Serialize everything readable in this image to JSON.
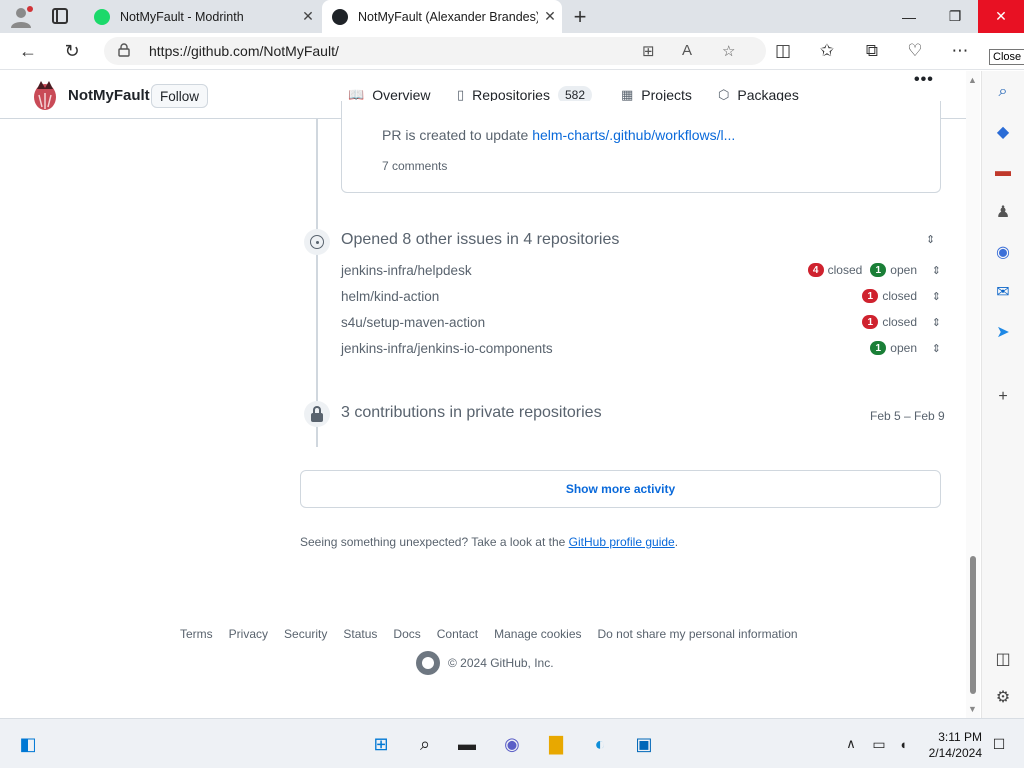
{
  "browser": {
    "tabs": [
      {
        "title": "NotMyFault - Modrinth",
        "active": false
      },
      {
        "title": "NotMyFault (Alexander Brandes)",
        "active": true
      }
    ],
    "url": "https://github.com/NotMyFault/",
    "close_tooltip": "Close"
  },
  "profile": {
    "username": "NotMyFault",
    "follow_label": "Follow"
  },
  "nav": {
    "tabs": [
      {
        "label": "Overview",
        "icon": "book-icon",
        "selected": true
      },
      {
        "label": "Repositories",
        "icon": "repo-icon",
        "count": "582"
      },
      {
        "label": "Projects",
        "icon": "table-icon"
      },
      {
        "label": "Packages",
        "icon": "package-icon"
      }
    ],
    "more": "•••"
  },
  "activity": {
    "card": {
      "text_prefix": "PR is created to update ",
      "text_link": "helm-charts/.github/workflows/l...",
      "comments": "7 comments"
    },
    "opened_issues": {
      "title": "Opened 8 other issues in 4 repositories",
      "rows": [
        {
          "repo": "jenkins-infra/helpdesk",
          "closed": "4",
          "closed_label": "closed",
          "open": "1",
          "open_label": "open"
        },
        {
          "repo": "helm/kind-action",
          "closed": "1",
          "closed_label": "closed"
        },
        {
          "repo": "s4u/setup-maven-action",
          "closed": "1",
          "closed_label": "closed"
        },
        {
          "repo": "jenkins-infra/jenkins-io-components",
          "open": "1",
          "open_label": "open"
        }
      ]
    },
    "private": {
      "title": "3 contributions in private repositories",
      "date": "Feb 5 – Feb 9"
    },
    "show_more": "Show more activity",
    "unexpected_prefix": "Seeing something unexpected? Take a look at the ",
    "unexpected_link": "GitHub profile guide",
    "unexpected_suffix": "."
  },
  "footer": {
    "links": [
      "Terms",
      "Privacy",
      "Security",
      "Status",
      "Docs",
      "Contact",
      "Manage cookies",
      "Do not share my personal information"
    ],
    "copyright": "© 2024 GitHub, Inc."
  },
  "taskbar": {
    "time": "3:11 PM",
    "date": "2/14/2024"
  },
  "colors": {
    "link": "#0969da",
    "closed": "#cf222e",
    "open": "#1a7f37",
    "close_button": "#e81123",
    "tab_accent": "#fd8c73"
  }
}
